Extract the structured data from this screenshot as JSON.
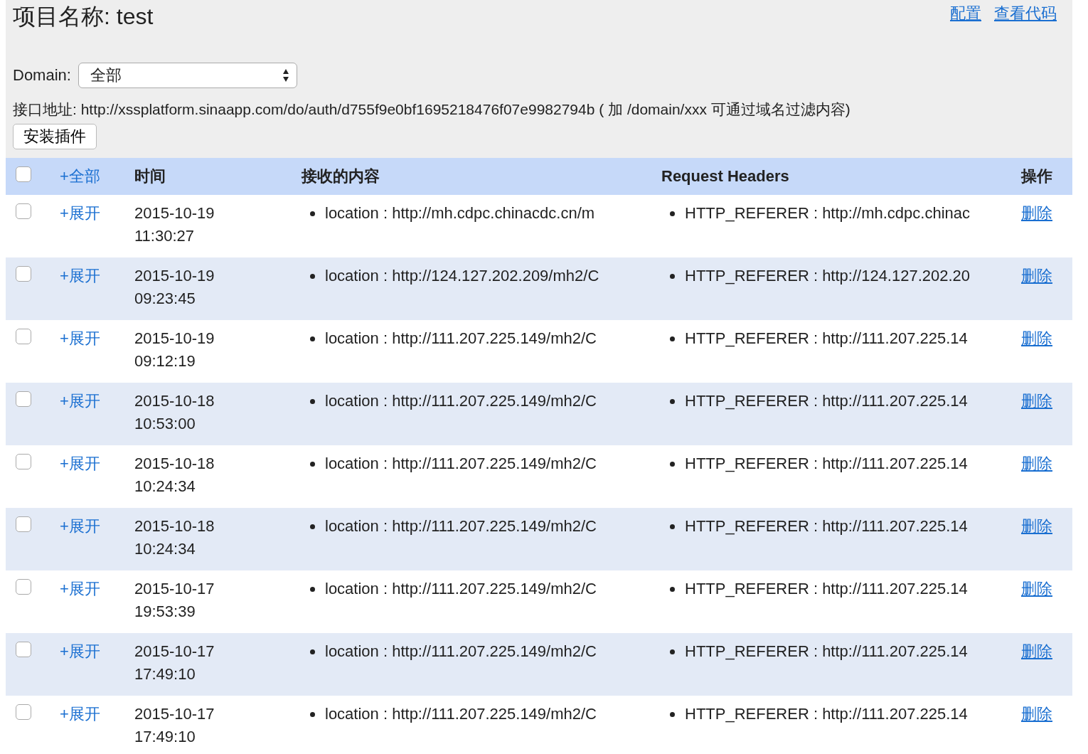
{
  "title": "项目名称: test",
  "links": [
    "配置",
    "查看代码"
  ],
  "domain": {
    "label": "Domain:",
    "value": "全部"
  },
  "endpoint": "接口地址: http://xssplatform.sinaapp.com/do/auth/d755f9e0bf1695218476f07e9982794b ( 加 /domain/xxx 可通过域名过滤内容)",
  "install_button": "安装插件",
  "table": {
    "select_all": {
      "checked": false
    },
    "columns": [
      "+全部",
      "时间",
      "接收的内容",
      "Request Headers",
      "操作"
    ],
    "rows": [
      {
        "checked": false,
        "expand": "+展开",
        "date": "2015-10-19",
        "time": "11:30:27",
        "content": "location : http://mh.cdpc.chinacdc.cn/m",
        "header": "HTTP_REFERER : http://mh.cdpc.chinac",
        "action": "删除"
      },
      {
        "checked": false,
        "expand": "+展开",
        "date": "2015-10-19",
        "time": "09:23:45",
        "content": "location : http://124.127.202.209/mh2/C",
        "header": "HTTP_REFERER : http://124.127.202.20",
        "action": "删除"
      },
      {
        "checked": false,
        "expand": "+展开",
        "date": "2015-10-19",
        "time": "09:12:19",
        "content": "location : http://111.207.225.149/mh2/C",
        "header": "HTTP_REFERER : http://111.207.225.14",
        "action": "删除"
      },
      {
        "checked": false,
        "expand": "+展开",
        "date": "2015-10-18",
        "time": "10:53:00",
        "content": "location : http://111.207.225.149/mh2/C",
        "header": "HTTP_REFERER : http://111.207.225.14",
        "action": "删除"
      },
      {
        "checked": false,
        "expand": "+展开",
        "date": "2015-10-18",
        "time": "10:24:34",
        "content": "location : http://111.207.225.149/mh2/C",
        "header": "HTTP_REFERER : http://111.207.225.14",
        "action": "删除"
      },
      {
        "checked": false,
        "expand": "+展开",
        "date": "2015-10-18",
        "time": "10:24:34",
        "content": "location : http://111.207.225.149/mh2/C",
        "header": "HTTP_REFERER : http://111.207.225.14",
        "action": "删除"
      },
      {
        "checked": false,
        "expand": "+展开",
        "date": "2015-10-17",
        "time": "19:53:39",
        "content": "location : http://111.207.225.149/mh2/C",
        "header": "HTTP_REFERER : http://111.207.225.14",
        "action": "删除"
      },
      {
        "checked": false,
        "expand": "+展开",
        "date": "2015-10-17",
        "time": "17:49:10",
        "content": "location : http://111.207.225.149/mh2/C",
        "header": "HTTP_REFERER : http://111.207.225.14",
        "action": "删除"
      },
      {
        "checked": false,
        "expand": "+展开",
        "date": "2015-10-17",
        "time": "17:49:10",
        "content": "location : http://111.207.225.149/mh2/C",
        "header": "HTTP_REFERER : http://111.207.225.14",
        "action": "删除"
      }
    ]
  }
}
